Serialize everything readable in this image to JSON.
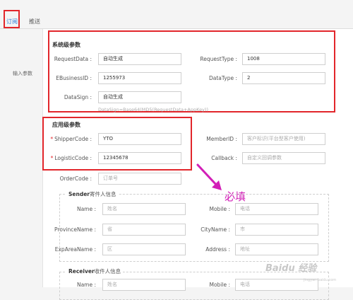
{
  "tabs": {
    "subscribe": "订阅",
    "push": "推送"
  },
  "left_nav": {
    "item": "输入参数"
  },
  "system_params": {
    "title": "系统级参数",
    "request_data": {
      "label": "RequestData :",
      "value": "自动生成"
    },
    "request_type": {
      "label": "RequestType :",
      "value": "1008"
    },
    "ebusiness_id": {
      "label": "EBusinessID :",
      "value": "1255973"
    },
    "data_type": {
      "label": "DataType :",
      "value": "2"
    },
    "data_sign": {
      "label": "DataSign :",
      "value": "自动生成"
    },
    "data_sign_hint": "DataSign=Base64(MD5(RequestData+AppKey))"
  },
  "app_params": {
    "title": "应用级参数",
    "shipper_code": {
      "label": "ShipperCode :",
      "value": "YTO",
      "required": "*"
    },
    "member_id": {
      "label": "MemberID :",
      "placeholder": "客户标识(平台型客户使用)"
    },
    "logistic_code": {
      "label": "LogisticCode :",
      "value": "12345678",
      "required": "*"
    },
    "callback": {
      "label": "Callback :",
      "placeholder": "自定义回调参数"
    },
    "order_code": {
      "label": "OrderCode :",
      "placeholder": "订单号"
    }
  },
  "sender": {
    "legend_en": "Sender",
    "legend_cn": "寄件人信息",
    "name": {
      "label": "Name :",
      "placeholder": "姓名"
    },
    "mobile": {
      "label": "Mobile :",
      "placeholder": "电话"
    },
    "province": {
      "label": "ProvinceName :",
      "placeholder": "省"
    },
    "city": {
      "label": "CityName :",
      "placeholder": "市"
    },
    "exp_area": {
      "label": "ExpAreaName :",
      "placeholder": "区"
    },
    "address": {
      "label": "Address :",
      "placeholder": "地址"
    }
  },
  "receiver": {
    "legend_en": "Receiver",
    "legend_cn": "收件人信息",
    "name": {
      "label": "Name :",
      "placeholder": "姓名"
    },
    "mobile": {
      "label": "Mobile :",
      "placeholder": "电话"
    }
  },
  "annotation": "必填",
  "watermark": {
    "brand": "Baidu 经验",
    "url": "jingyan.baidu.com"
  },
  "colors": {
    "accent": "#2a7ad8",
    "highlight": "#e2262b",
    "annotation": "#d21fb7"
  }
}
